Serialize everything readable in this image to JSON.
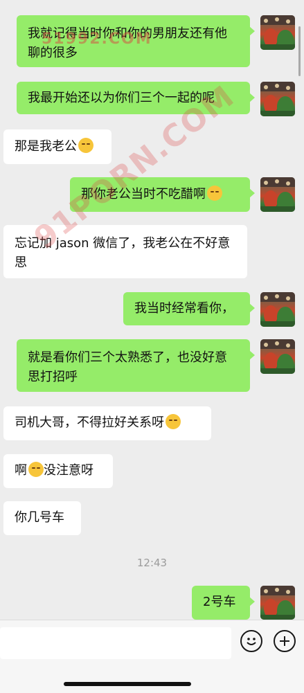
{
  "messages": [
    {
      "side": "me",
      "text": "我就记得当时你和你的男朋友还有他聊的很多"
    },
    {
      "side": "me",
      "text": "我最开始还以为你们三个一起的呢"
    },
    {
      "side": "them",
      "text": "那是我老公",
      "emoji": "grin-squint-emoji"
    },
    {
      "side": "me",
      "text": "那你老公当时不吃醋啊",
      "emoji": "thinking-emoji"
    },
    {
      "side": "them",
      "text": "忘记加 jason 微信了，我老公在不好意思"
    },
    {
      "side": "me",
      "text": "我当时经常看你，"
    },
    {
      "side": "me",
      "text": "就是看你们三个太熟悉了，也没好意思打招呼"
    },
    {
      "side": "them",
      "text": "司机大哥，不得拉好关系呀",
      "emoji": "thinking-emoji"
    },
    {
      "side": "them",
      "text_before": "啊",
      "emoji": "laugh-cry-emoji",
      "text_after": "没注意呀"
    },
    {
      "side": "them",
      "text": "你几号车"
    },
    {
      "side": "me",
      "text": "2号车"
    }
  ],
  "timestamp": "12:43",
  "watermark": {
    "top": "51992.COM",
    "diag": "91PORN.COM"
  },
  "input": {
    "voice_icon": "emoji-face-icon",
    "plus_icon": "plus-circle-icon"
  },
  "colors": {
    "background": "#ededed",
    "me_bubble": "#95ec69",
    "them_bubble": "#ffffff"
  }
}
